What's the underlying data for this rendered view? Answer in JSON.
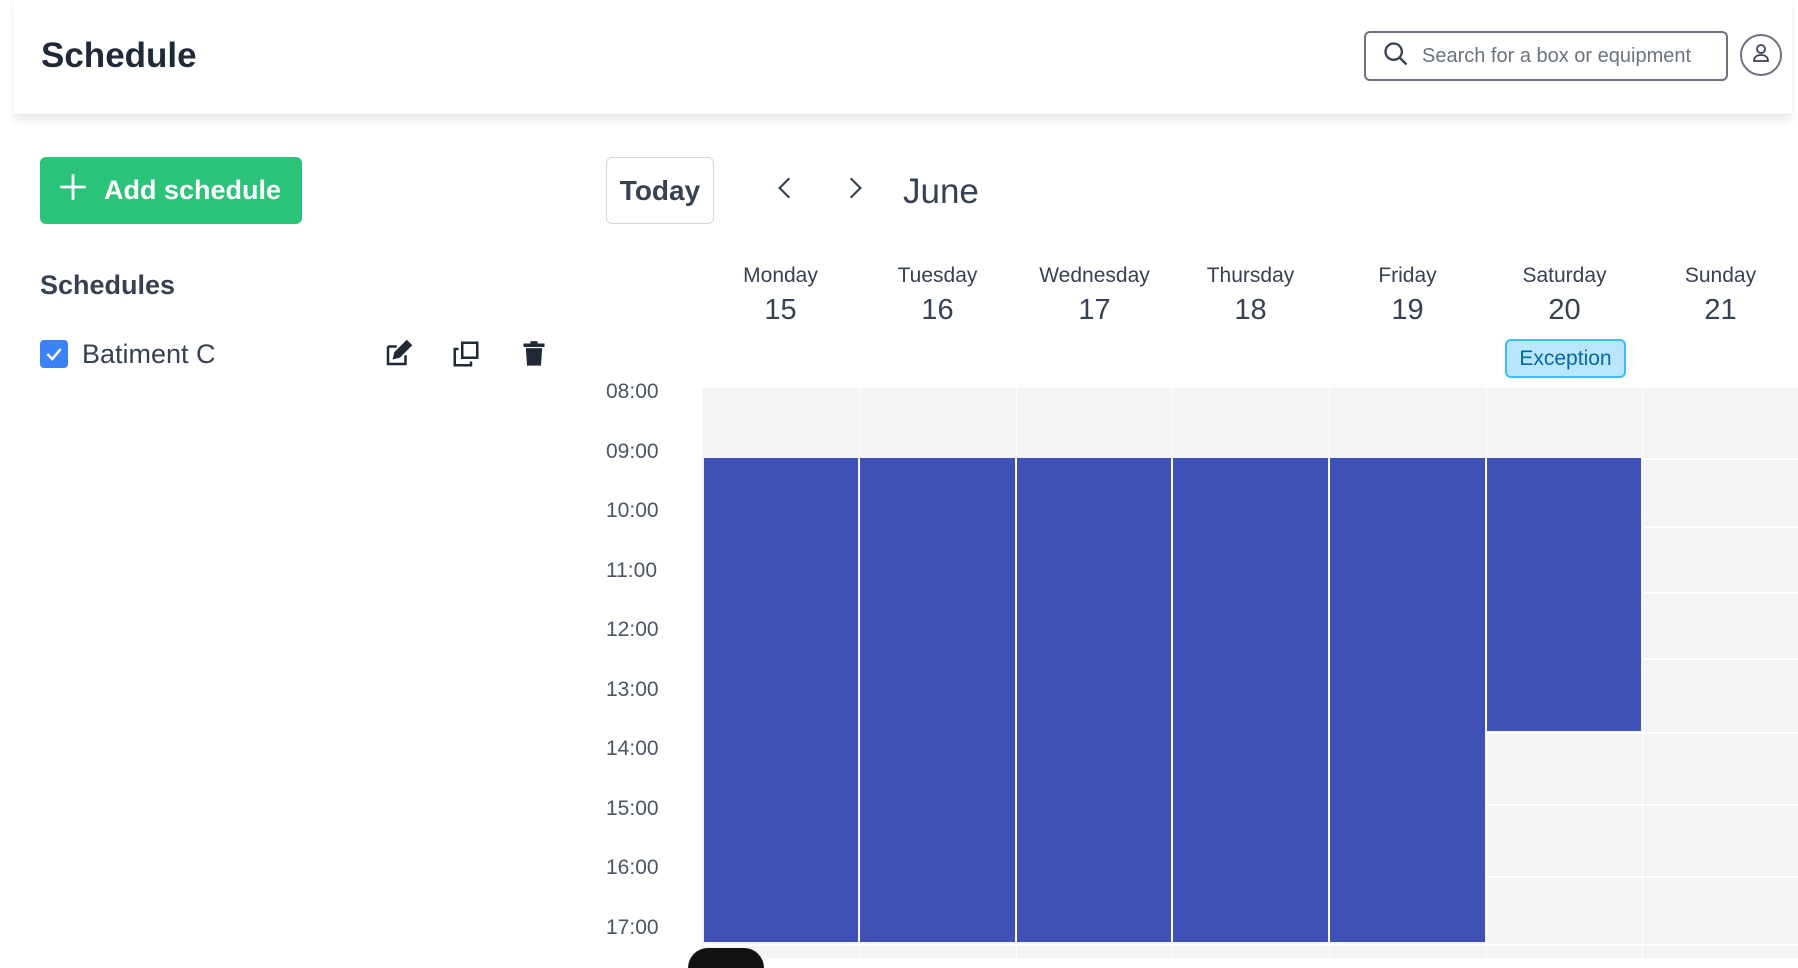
{
  "header": {
    "title": "Schedule",
    "search_placeholder": "Search for a box or equipment"
  },
  "sidebar": {
    "add_button_label": "Add schedule",
    "schedules_heading": "Schedules",
    "items": [
      {
        "label": "Batiment C",
        "checked": true
      }
    ]
  },
  "calendar": {
    "today_label": "Today",
    "month_label": "June",
    "exception_label": "Exception",
    "days": [
      {
        "name": "Monday",
        "num": "15"
      },
      {
        "name": "Tuesday",
        "num": "16"
      },
      {
        "name": "Wednesday",
        "num": "17"
      },
      {
        "name": "Thursday",
        "num": "18"
      },
      {
        "name": "Friday",
        "num": "19"
      },
      {
        "name": "Saturday",
        "num": "20"
      },
      {
        "name": "Sunday",
        "num": "21"
      }
    ],
    "times": [
      "08:00",
      "09:00",
      "10:00",
      "11:00",
      "12:00",
      "13:00",
      "14:00",
      "15:00",
      "16:00",
      "17:00"
    ],
    "events": [
      {
        "day": "Monday",
        "start": "09:00",
        "end": "17:00+"
      },
      {
        "day": "Tuesday",
        "start": "09:00",
        "end": "17:00+"
      },
      {
        "day": "Wednesday",
        "start": "09:00",
        "end": "17:00+"
      },
      {
        "day": "Thursday",
        "start": "09:00",
        "end": "17:00+"
      },
      {
        "day": "Friday",
        "start": "09:00",
        "end": "17:00+"
      },
      {
        "day": "Saturday",
        "start": "09:00",
        "end": "13:30"
      }
    ]
  },
  "colors": {
    "accent_green": "#2bc27a",
    "event_blue": "#3f51b5",
    "exception_bg": "#bae6fd"
  }
}
